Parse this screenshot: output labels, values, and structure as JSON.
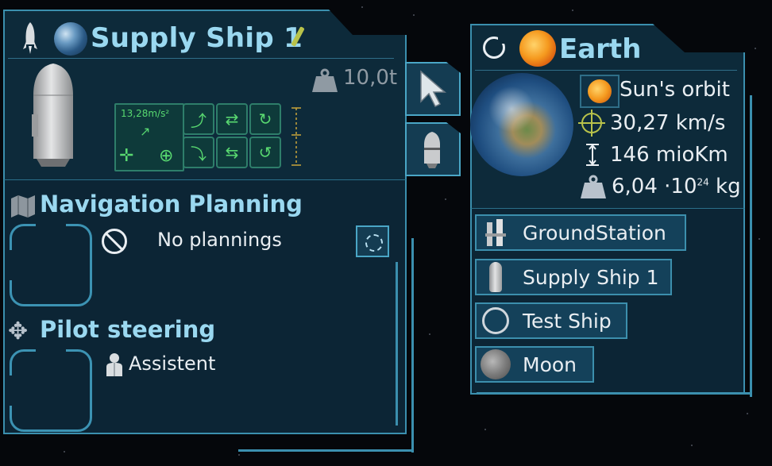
{
  "ship_panel": {
    "title": "Supply Ship 1",
    "weight": "10,0t",
    "acceleration": "13,28m/s²",
    "navigation": {
      "title": "Navigation Planning",
      "status": "No plannings"
    },
    "pilot": {
      "title": "Pilot steering",
      "mode": "Assistent"
    }
  },
  "body_panel": {
    "title": "Earth",
    "orbit": "Sun's orbit",
    "velocity": "30,27 km/s",
    "distance": "146 mioKm",
    "mass_base": "6,04 ·10",
    "mass_exp": "24",
    "mass_unit": " kg",
    "objects": [
      {
        "label": "GroundStation",
        "icon": "ground-station-icon"
      },
      {
        "label": "Supply Ship 1",
        "icon": "ship-icon"
      },
      {
        "label": "Test Ship",
        "icon": "ring-station-icon"
      },
      {
        "label": "Moon",
        "icon": "moon-icon"
      }
    ]
  },
  "colors": {
    "title": "#9ad8f0",
    "panel_bg": "#0d2a3a",
    "border": "#3b8fae",
    "green_hud": "#58d870"
  }
}
